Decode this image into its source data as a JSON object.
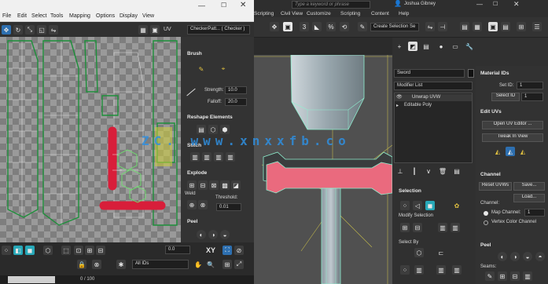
{
  "uv_menu": [
    "File",
    "Edit",
    "Select",
    "Tools",
    "Mapping",
    "Options",
    "Display",
    "View"
  ],
  "main_menu": [
    "Scripting",
    "Civil View",
    "Customize",
    "Scripting",
    "Content",
    "Help"
  ],
  "search_placeholder": "Type a keyword or phrase",
  "user_name": "Joshua Gibney",
  "uv_label": "UV",
  "checker_label": "CheckerPatt... ( Checker )",
  "create_selection_set": "Create Selection Se",
  "brush": {
    "title": "Brush",
    "strength_label": "Strength:",
    "strength_value": "10.0",
    "falloff_label": "Falloff:",
    "falloff_value": "20.0"
  },
  "reshape": {
    "title": "Reshape Elements"
  },
  "stitch": {
    "title": "Stitch"
  },
  "explode": {
    "title": "Explode",
    "weld_label": "Weld",
    "threshold_label": "Threshold:",
    "threshold_value": "0.01"
  },
  "peel_left": {
    "title": "Peel"
  },
  "object_name": "Sword",
  "modifier_list": "Modifier List",
  "stack": [
    "Unwrap UVW",
    "Editable Poly"
  ],
  "selection": {
    "title": "Selection",
    "modify_selection": "Modify Selection",
    "select_by": "Select By"
  },
  "material_ids": {
    "title": "Material IDs",
    "set_id": "Set ID:",
    "select_id": "Select ID"
  },
  "edit_uvs": {
    "title": "Edit UVs",
    "open_editor": "Open UV Editor ...",
    "tweak": "Tweak In View"
  },
  "channel": {
    "title": "Channel",
    "reset": "Reset UVWs",
    "save": "Save...",
    "load": "Load...",
    "channel_label": "Channel:",
    "map_channel": "Map Channel:",
    "vertex_color": "Vertex Color Channel",
    "map_value": "1"
  },
  "peel_right": {
    "title": "Peel",
    "seams": "Seams:"
  },
  "all_ids": "All IDs",
  "xy": "XY",
  "frame": "0 / 100",
  "watermark": "ZC.  www.xnxxfb.co"
}
